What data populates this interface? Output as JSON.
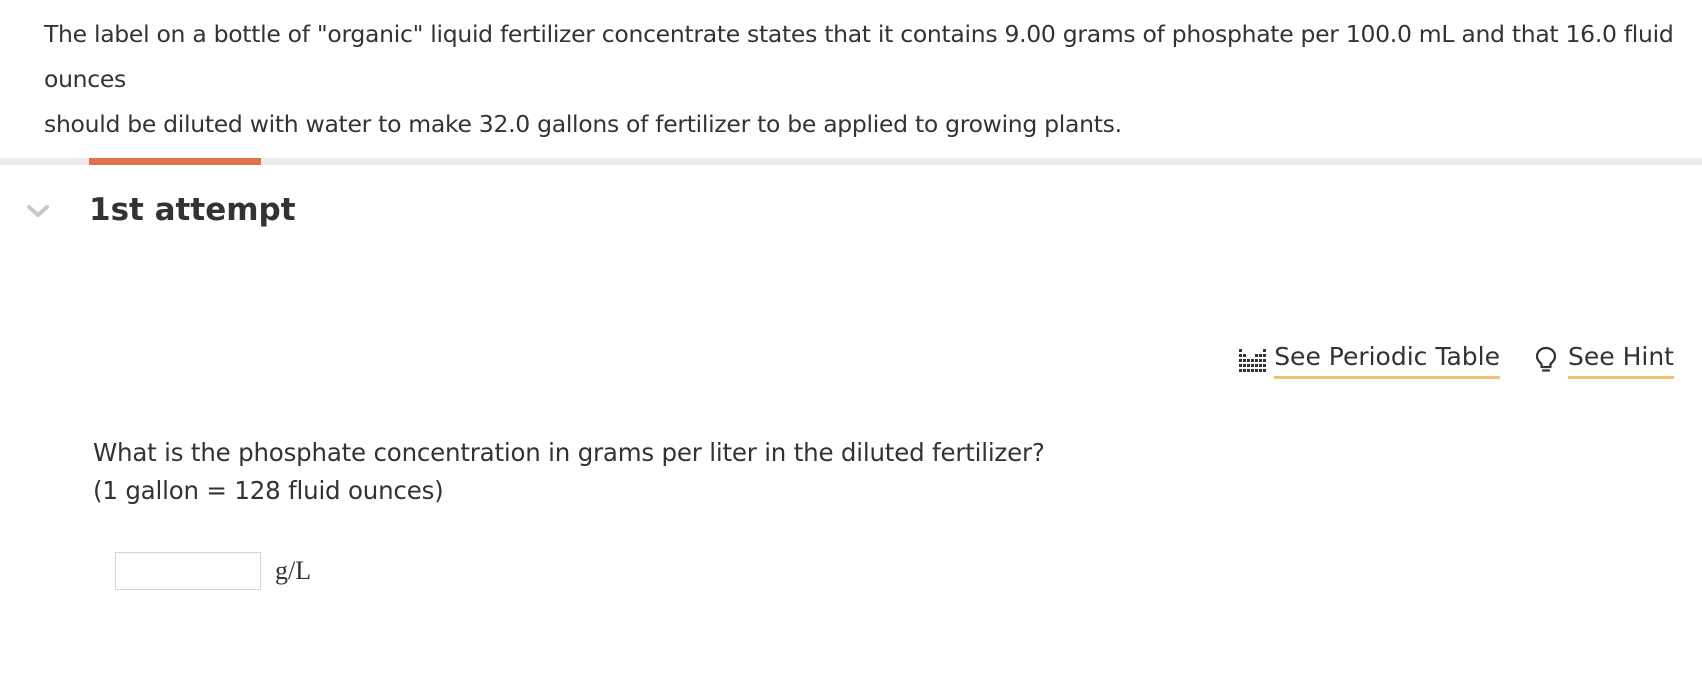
{
  "problem": {
    "line1": "The label on a bottle of \"organic\" liquid fertilizer concentrate states that it contains 9.00 grams of phosphate per 100.0 mL and that 16.0 fluid ounces",
    "line2": "should be diluted with water to make 32.0 gallons of fertilizer to be applied to growing plants."
  },
  "attempt": {
    "title": "1st attempt",
    "toggle_icon": "chevron-down-icon"
  },
  "tools": {
    "periodic_table": {
      "label": "See Periodic Table",
      "icon": "periodic-table-icon"
    },
    "hint": {
      "label": "See Hint",
      "icon": "lightbulb-icon"
    },
    "underline_color": "#f0c36d"
  },
  "question": {
    "line1": "What is the phosphate concentration in grams per liter in the diluted fertilizer?",
    "line2": "(1 gallon = 128 fluid ounces)"
  },
  "answer": {
    "value": "",
    "placeholder": "",
    "unit": "g/L"
  },
  "colors": {
    "accent": "#e2714f",
    "track": "#ececec",
    "text": "#333333"
  }
}
